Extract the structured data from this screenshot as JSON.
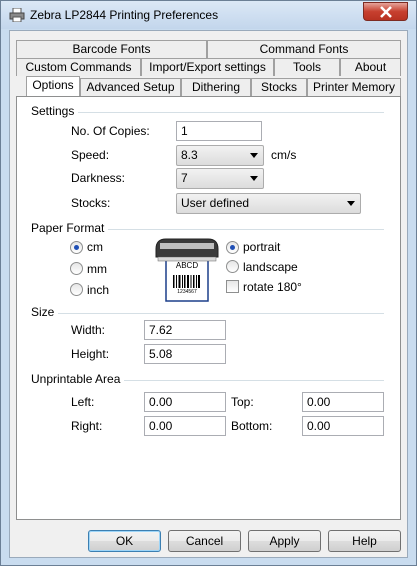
{
  "window": {
    "title": "Zebra LP2844 Printing Preferences"
  },
  "tabs": {
    "row1": [
      "Barcode Fonts",
      "Command Fonts"
    ],
    "row2": [
      "Custom Commands",
      "Import/Export settings",
      "Tools",
      "About"
    ],
    "row3": [
      "Options",
      "Advanced Setup",
      "Dithering",
      "Stocks",
      "Printer Memory"
    ],
    "active": "Options"
  },
  "settings": {
    "group_label": "Settings",
    "copies_label": "No. Of Copies:",
    "copies_value": "1",
    "speed_label": "Speed:",
    "speed_value": "8.3",
    "speed_unit": "cm/s",
    "darkness_label": "Darkness:",
    "darkness_value": "7",
    "stocks_label": "Stocks:",
    "stocks_value": "User defined"
  },
  "paper_format": {
    "group_label": "Paper Format",
    "units": [
      "cm",
      "mm",
      "inch"
    ],
    "selected_unit": "cm",
    "orientations": [
      "portrait",
      "landscape"
    ],
    "selected_orientation": "portrait",
    "rotate_label": "rotate 180°",
    "rotate_checked": false,
    "label_preview_text": "ABCD",
    "label_preview_number": "1234567"
  },
  "size": {
    "group_label": "Size",
    "width_label": "Width:",
    "width_value": "7.62",
    "height_label": "Height:",
    "height_value": "5.08"
  },
  "unprintable": {
    "group_label": "Unprintable Area",
    "left_label": "Left:",
    "left_value": "0.00",
    "top_label": "Top:",
    "top_value": "0.00",
    "right_label": "Right:",
    "right_value": "0.00",
    "bottom_label": "Bottom:",
    "bottom_value": "0.00"
  },
  "buttons": {
    "ok": "OK",
    "cancel": "Cancel",
    "apply": "Apply",
    "help": "Help"
  },
  "colors": {
    "titlebar": "#c9dcef",
    "close": "#c7402f",
    "radio_dot": "#1f4fb5"
  }
}
